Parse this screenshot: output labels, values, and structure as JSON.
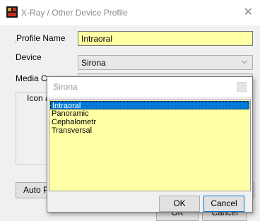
{
  "window": {
    "title": "X-Ray / Other Device Profile",
    "close_glyph": "✕"
  },
  "form": {
    "profile_name_label": "Profile Name",
    "profile_name_value": "Intraoral",
    "device_label": "Device",
    "device_value": "Sirona",
    "media_label": "Media Ca",
    "icon_label": "Icon a"
  },
  "buttons": {
    "auto_label": "Auto Pr",
    "ok_bg": "OK",
    "cancel_bg": "Cancel"
  },
  "popup": {
    "title": "Sirona",
    "items": [
      "Intraoral",
      "Panoramic",
      "Cephalometr",
      "Transversal"
    ],
    "selected_index": 0,
    "ok_label": "OK",
    "cancel_label": "Cancel"
  },
  "colors": {
    "field_highlight": "#ffffa6",
    "selection": "#0078d7"
  }
}
